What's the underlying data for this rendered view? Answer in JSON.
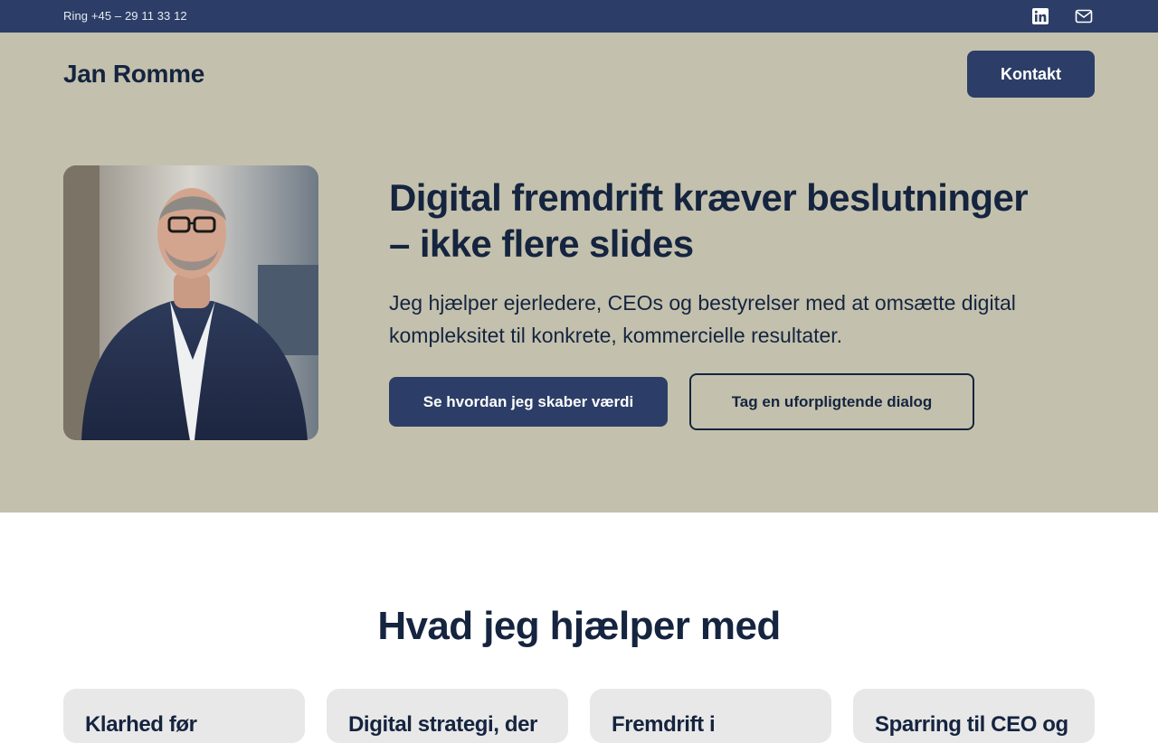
{
  "topbar": {
    "phone": "Ring +45 – 29 11 33 12",
    "icons": [
      "linkedin-icon",
      "mail-icon"
    ]
  },
  "header": {
    "brand": "Jan Romme",
    "contact_label": "Kontakt"
  },
  "hero": {
    "headline_line1": "Digital fremdrift kræver beslutninger",
    "headline_line2": "– ikke flere slides",
    "lead": "Jeg hjælper ejerledere, CEOs og bestyrelser med at omsætte digital kompleksitet til konkrete, kommercielle resultater.",
    "primary_cta": "Se hvordan jeg skaber værdi",
    "secondary_cta": "Tag en uforpligtende dialog"
  },
  "services": {
    "title": "Hvad jeg hjælper med",
    "cards": [
      {
        "title": "Klarhed før"
      },
      {
        "title": "Digital strategi, der"
      },
      {
        "title": "Fremdrift i"
      },
      {
        "title": "Sparring til CEO og"
      }
    ]
  },
  "colors": {
    "navy": "#2c3e67",
    "ink": "#15243f",
    "hero_bg": "#c3c1ad",
    "card_bg": "#e8e8e8"
  }
}
